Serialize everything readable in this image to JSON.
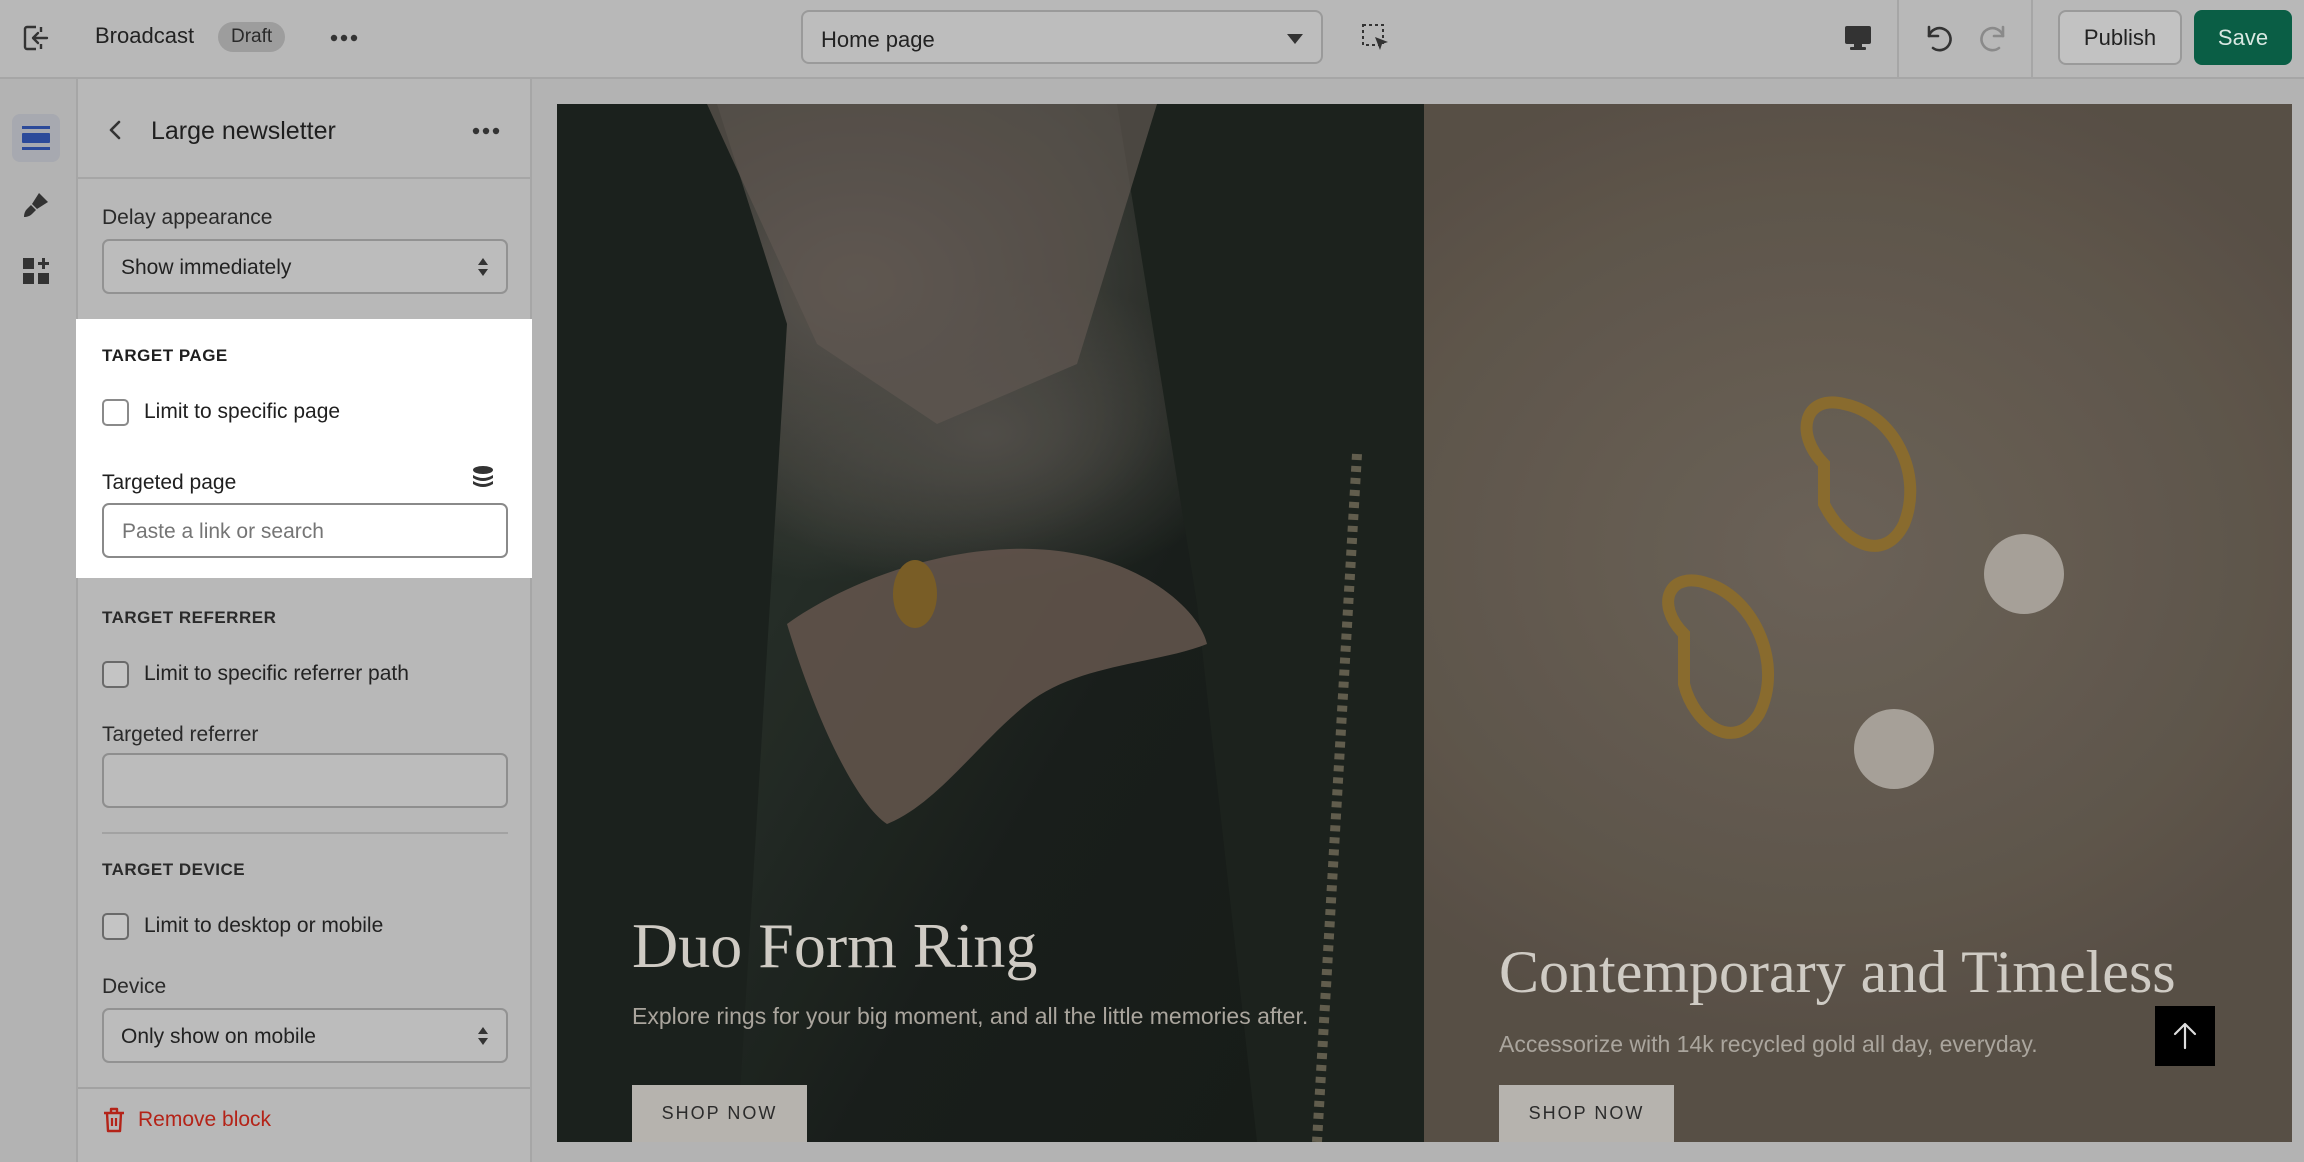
{
  "topbar": {
    "title": "Broadcast",
    "badge": "Draft",
    "page_select": "Home page",
    "publish_label": "Publish",
    "save_label": "Save"
  },
  "panel": {
    "title": "Large newsletter",
    "delay": {
      "label": "Delay appearance",
      "value": "Show immediately"
    },
    "target_page": {
      "heading": "TARGET PAGE",
      "checkbox_label": "Limit to specific page",
      "field_label": "Targeted page",
      "placeholder": "Paste a link or search"
    },
    "target_referrer": {
      "heading": "TARGET REFERRER",
      "checkbox_label": "Limit to specific referrer path",
      "field_label": "Targeted referrer",
      "value": ""
    },
    "target_device": {
      "heading": "TARGET DEVICE",
      "checkbox_label": "Limit to desktop or mobile",
      "field_label": "Device",
      "value": "Only show on mobile"
    },
    "remove_label": "Remove block"
  },
  "preview": {
    "slides": [
      {
        "title": "Duo Form Ring",
        "text": "Explore rings for your big moment, and all the little memories after.",
        "button": "SHOP NOW"
      },
      {
        "title": "Contemporary and Timeless",
        "text": "Accessorize with 14k recycled gold all day, everyday.",
        "button": "SHOP NOW"
      }
    ]
  },
  "colors": {
    "save": "#0a5e45",
    "remove": "#b42318",
    "highlight": "#ffffff"
  }
}
